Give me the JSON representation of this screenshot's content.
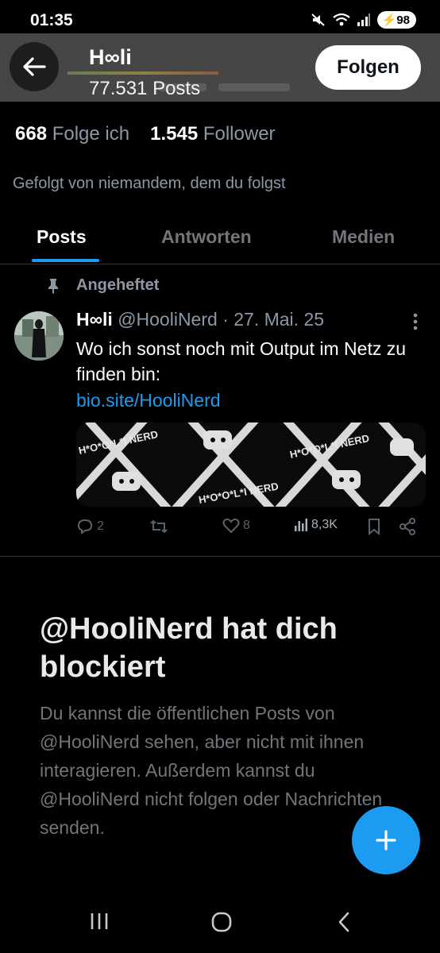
{
  "status_bar": {
    "time": "01:35",
    "battery": "98"
  },
  "header": {
    "name": "H∞li",
    "posts_count": "77.531 Posts",
    "follow_label": "Folgen"
  },
  "stats": {
    "following_count": "668",
    "following_label": "Folge ich",
    "followers_count": "1.545",
    "followers_label": "Follower"
  },
  "followed_by": "Gefolgt von niemandem, dem du folgst",
  "tabs": [
    {
      "label": "Posts",
      "active": true
    },
    {
      "label": "Antworten"
    },
    {
      "label": "Medien"
    }
  ],
  "pinned_post": {
    "pinned_label": "Angeheftet",
    "author_name": "H∞li",
    "handle_date": "@HooliNerd · 27. Mai. 25",
    "text": "Wo ich sonst noch mit Output im Netz zu finden bin:",
    "link": "bio.site/HooliNerd",
    "media_text": "H*O*O*L*I NERD",
    "replies": "2",
    "reposts": "",
    "likes": "8",
    "views": "8,3K"
  },
  "blocked": {
    "title": "@HooliNerd hat dich blockiert",
    "description": "Du kannst die öffentlichen Posts von @HooliNerd sehen, aber nicht mit ihnen interagieren. Außerdem kannst du @HooliNerd nicht folgen oder Nachrichten senden."
  },
  "colors": {
    "accent": "#1d9bf0",
    "background": "#000000",
    "secondary_text": "#71767b"
  },
  "icons": [
    "mute-icon",
    "wifi-icon",
    "signal-icon",
    "back-arrow-icon",
    "pin-icon",
    "more-icon",
    "reply-icon",
    "repost-icon",
    "like-icon",
    "views-icon",
    "bookmark-icon",
    "share-icon",
    "compose-plus-icon",
    "recents-icon",
    "home-icon",
    "back-nav-icon"
  ]
}
